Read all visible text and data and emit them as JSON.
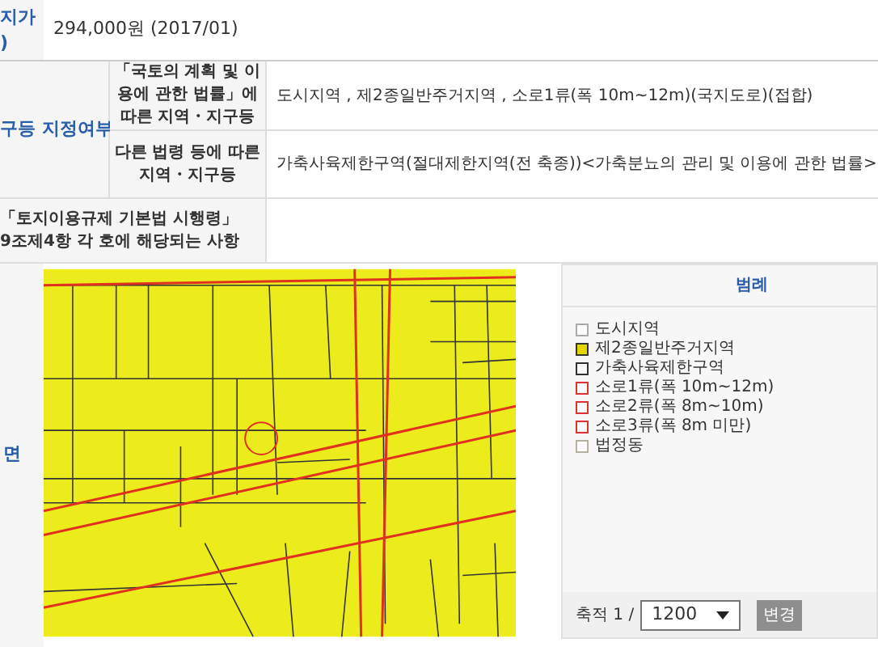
{
  "rows": [
    {
      "header": "지가\n)",
      "value": "294,000원 (2017/01)"
    },
    {
      "header": "구등 지정여부",
      "subrows": [
        {
          "label": "「국토의 계획 및 이용에 관한 법률」에 따른 지역・지구등",
          "value": "도시지역 , 제2종일반주거지역 , 소로1류(폭 10m~12m)(국지도로)(접합)"
        },
        {
          "label": "다른 법령 등에 따른 지역・지구등",
          "value": "가축사육제한구역(절대제한지역(전 축종))<가축분뇨의 관리 및 이용에 관한 법률>"
        }
      ]
    },
    {
      "header": "「토지이용규제 기본법 시행령」\n9조제4항 각 호에 해당되는 사항"
    },
    {
      "header": "면"
    }
  ],
  "legend": {
    "title": "범례",
    "items": [
      {
        "label": "도시지역",
        "kind": "outline",
        "color": "#aaaaaa"
      },
      {
        "label": "제2종일반주거지역",
        "kind": "filled",
        "color": "#333333"
      },
      {
        "label": "가축사육제한구역",
        "kind": "outline",
        "color": "#333333"
      },
      {
        "label": "소로1류(폭 10m~12m)",
        "kind": "outline",
        "color": "#e03030"
      },
      {
        "label": "소로2류(폭 8m~10m)",
        "kind": "outline",
        "color": "#e03030"
      },
      {
        "label": "소로3류(폭 8m 미만)",
        "kind": "outline",
        "color": "#e03030"
      },
      {
        "label": "법정동",
        "kind": "outline",
        "color": "#b8b0a0"
      }
    ]
  },
  "scale": {
    "label": "축적 1 /",
    "value": "1200",
    "button": "변경"
  }
}
